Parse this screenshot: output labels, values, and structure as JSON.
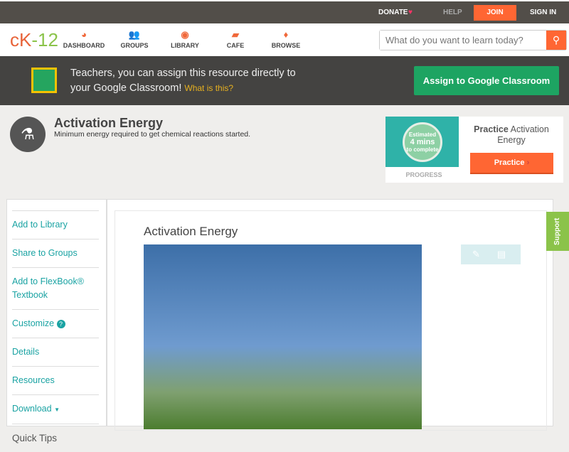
{
  "topbar": {
    "donate": "DONATE",
    "help": "HELP",
    "join": "JOIN",
    "signin": "SIGN IN"
  },
  "nav": {
    "logo_a": "cK",
    "logo_b": "-12",
    "items": [
      "DASHBOARD",
      "GROUPS",
      "LIBRARY",
      "CAFE",
      "BROWSE"
    ],
    "search_placeholder": "What do you want to learn today?"
  },
  "gc": {
    "line1": "Teachers, you can assign this resource directly to",
    "line2": "your Google Classroom!",
    "link": "What is this?",
    "button": "Assign to Google Classroom"
  },
  "concept": {
    "title": "Activation Energy",
    "subtitle": "Minimum energy required to get chemical reactions started."
  },
  "practice": {
    "est1": "Estimated",
    "est2": "4 mins",
    "est3": "to complete",
    "progress": "PROGRESS",
    "title_bold": "Practice",
    "title_rest": "Activation Energy",
    "button": "Practice"
  },
  "sidebar": [
    "Add to Library",
    "Share to Groups",
    "Add to FlexBook® Textbook",
    "Customize",
    "Details",
    "Resources",
    "Download",
    "Quick Tips"
  ],
  "main": {
    "heading": "Activation Energy"
  },
  "support": "Support"
}
